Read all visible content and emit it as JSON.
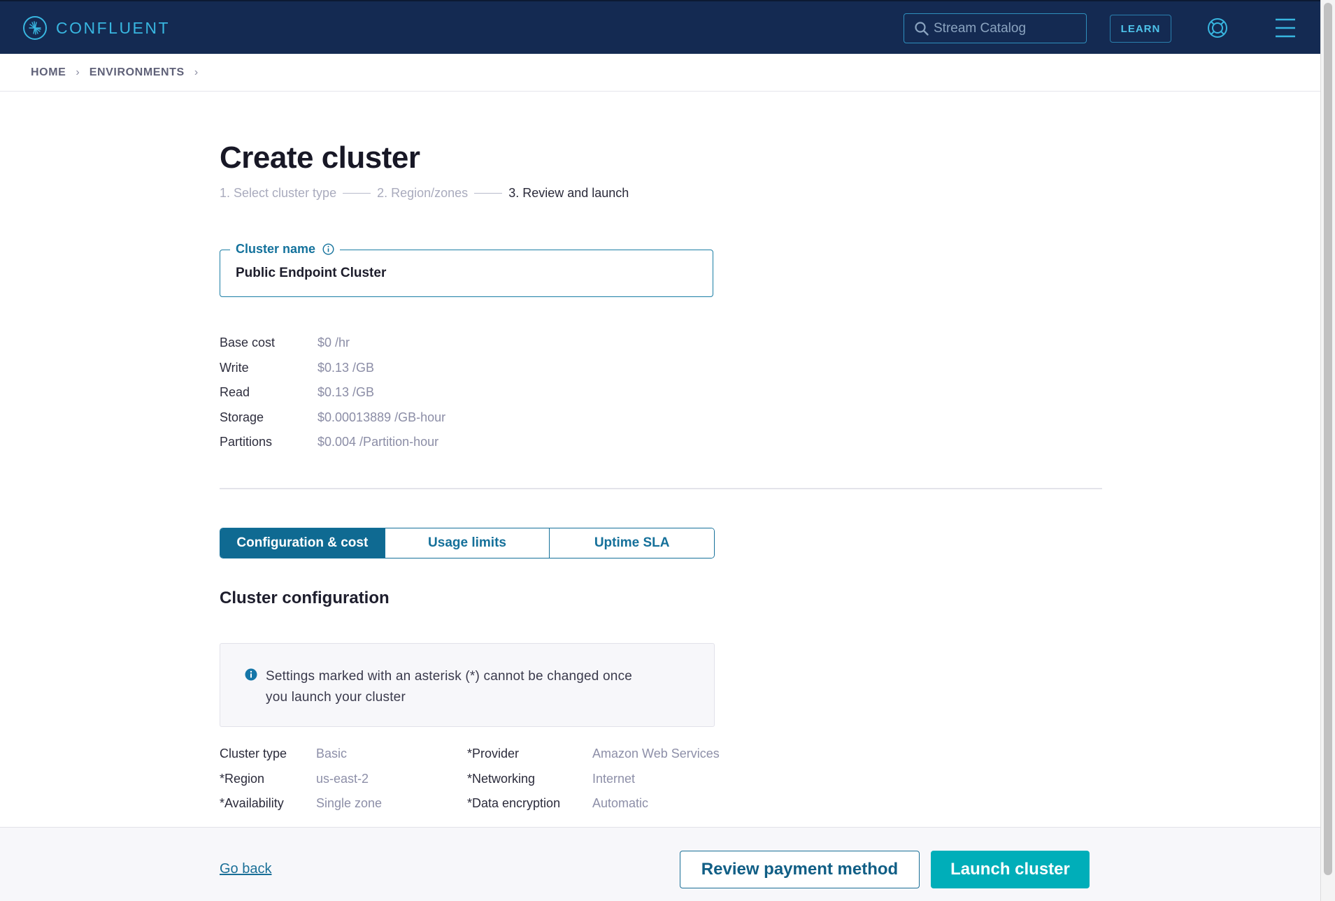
{
  "header": {
    "brand": "CONFLUENT",
    "search": {
      "placeholder": "Stream Catalog",
      "value": ""
    },
    "learn_label": "LEARN",
    "colors": {
      "nav_bg": "#142a52",
      "accent": "#38b6e0"
    }
  },
  "breadcrumb": {
    "items": [
      {
        "label": "HOME"
      },
      {
        "label": "ENVIRONMENTS"
      }
    ]
  },
  "page": {
    "title": "Create cluster",
    "steps": [
      {
        "label": "1. Select cluster type",
        "state": "done"
      },
      {
        "label": "2. Region/zones",
        "state": "done"
      },
      {
        "label": "3. Review and launch",
        "state": "active"
      }
    ],
    "cluster_name": {
      "label": "Cluster name",
      "value": "Public Endpoint Cluster"
    },
    "costs": [
      {
        "label": "Base cost",
        "value": "$0 /hr"
      },
      {
        "label": "Write",
        "value": "$0.13 /GB"
      },
      {
        "label": "Read",
        "value": "$0.13 /GB"
      },
      {
        "label": "Storage",
        "value": "$0.00013889 /GB-hour"
      },
      {
        "label": "Partitions",
        "value": "$0.004 /Partition-hour"
      }
    ],
    "tabs": [
      {
        "label": "Configuration & cost",
        "active": true
      },
      {
        "label": "Usage limits",
        "active": false
      },
      {
        "label": "Uptime SLA",
        "active": false
      }
    ],
    "section_title": "Cluster configuration",
    "notice": "Settings marked with an asterisk (*) cannot be changed once you launch your cluster",
    "config": [
      {
        "label": "Cluster type",
        "value": "Basic"
      },
      {
        "label": "*Provider",
        "value": "Amazon Web Services"
      },
      {
        "label": "*Region",
        "value": "us-east-2"
      },
      {
        "label": "*Networking",
        "value": "Internet"
      },
      {
        "label": "*Availability",
        "value": "Single zone"
      },
      {
        "label": "*Data encryption",
        "value": "Automatic"
      }
    ]
  },
  "footer": {
    "go_back": "Go back",
    "review_payment": "Review payment method",
    "launch": "Launch cluster",
    "colors": {
      "primary": "#00aeb9",
      "link": "#1a6f97"
    }
  }
}
